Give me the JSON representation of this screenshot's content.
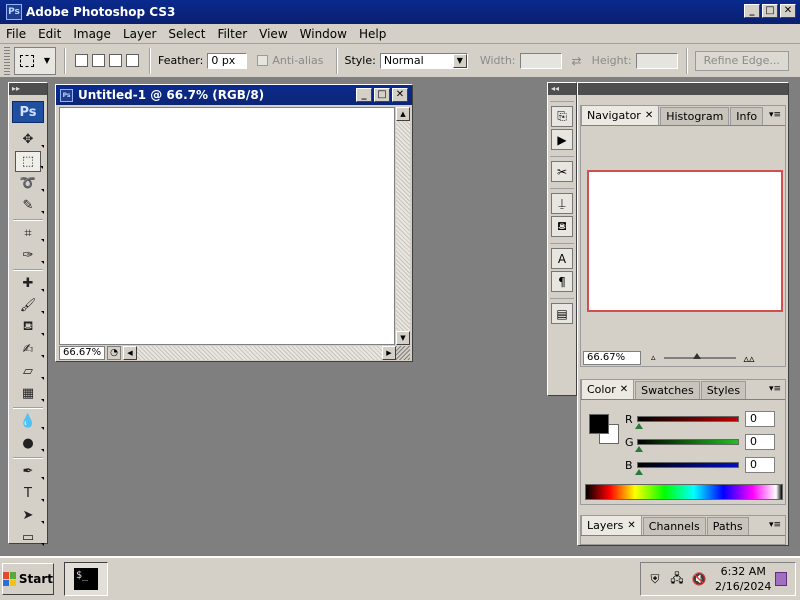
{
  "window": {
    "title": "Adobe Photoshop CS3",
    "app_icon": "Ps",
    "controls": [
      "minimize",
      "maximize",
      "close"
    ]
  },
  "menu": [
    "File",
    "Edit",
    "Image",
    "Layer",
    "Select",
    "Filter",
    "View",
    "Window",
    "Help"
  ],
  "options": {
    "feather_label": "Feather:",
    "feather_value": "0 px",
    "antialias_label": "Anti-alias",
    "style_label": "Style:",
    "style_value": "Normal",
    "width_label": "Width:",
    "height_label": "Height:",
    "refine_label": "Refine Edge..."
  },
  "toolbox": {
    "logo": "Ps",
    "tools": [
      {
        "name": "move-tool",
        "icon": "✥"
      },
      {
        "name": "marquee-tool",
        "icon": "⬚",
        "selected": true
      },
      {
        "name": "lasso-tool",
        "icon": "➰"
      },
      {
        "name": "quick-selection-tool",
        "icon": "✎"
      },
      {
        "name": "crop-tool",
        "icon": "⌗"
      },
      {
        "name": "slice-tool",
        "icon": "✑"
      },
      {
        "name": "healing-brush-tool",
        "icon": "✚"
      },
      {
        "name": "brush-tool",
        "icon": "🖌"
      },
      {
        "name": "clone-stamp-tool",
        "icon": "⛾"
      },
      {
        "name": "history-brush-tool",
        "icon": "✍"
      },
      {
        "name": "eraser-tool",
        "icon": "▱"
      },
      {
        "name": "gradient-tool",
        "icon": "▦"
      },
      {
        "name": "blur-tool",
        "icon": "💧"
      },
      {
        "name": "dodge-tool",
        "icon": "●"
      },
      {
        "name": "pen-tool",
        "icon": "✒"
      },
      {
        "name": "type-tool",
        "icon": "T"
      },
      {
        "name": "path-selection-tool",
        "icon": "➤"
      },
      {
        "name": "rectangle-tool",
        "icon": "▭"
      }
    ]
  },
  "document": {
    "title": "Untitled-1 @ 66.7% (RGB/8)",
    "zoom": "66.67%"
  },
  "navigator_panel": {
    "tabs": [
      "Navigator",
      "Histogram",
      "Info"
    ],
    "zoom": "66.67%",
    "zoom_slider_fraction": 0.47
  },
  "color_panel": {
    "tabs": [
      "Color",
      "Swatches",
      "Styles"
    ],
    "channels": [
      {
        "label": "R",
        "value": "0",
        "color": "#c00000"
      },
      {
        "label": "G",
        "value": "0",
        "color": "#20c020"
      },
      {
        "label": "B",
        "value": "0",
        "color": "#0010c0"
      }
    ],
    "foreground": "#000000",
    "background": "#ffffff"
  },
  "layers_panel": {
    "tabs": [
      "Layers",
      "Channels",
      "Paths"
    ]
  },
  "taskbar": {
    "start_label": "Start",
    "clock_time": "6:32 AM",
    "clock_date": "2/16/2024",
    "cmd_glyph": "$_"
  }
}
